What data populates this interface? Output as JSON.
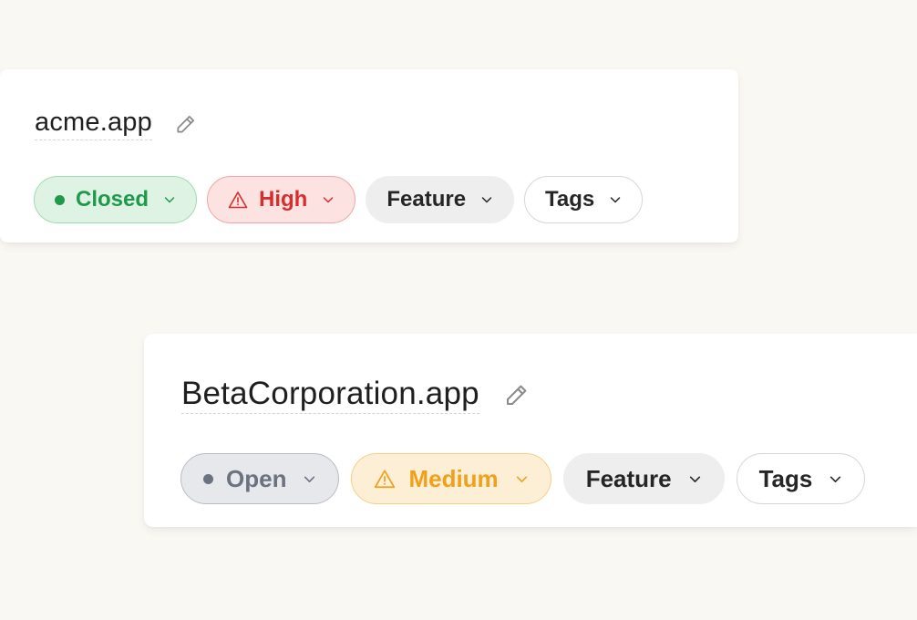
{
  "colors": {
    "background": "#faf8f3",
    "closed": "#1f9a4b",
    "high": "#d62d2d",
    "open": "#6b7280",
    "medium": "#f0a01b"
  },
  "cards": [
    {
      "title": "acme.app",
      "edit_icon": "pencil-icon",
      "pills": {
        "status": {
          "label": "Closed",
          "icon": "dot-icon"
        },
        "priority": {
          "label": "High",
          "icon": "warning-triangle-icon"
        },
        "type": {
          "label": "Feature"
        },
        "tags": {
          "label": "Tags"
        }
      }
    },
    {
      "title": "BetaCorporation.app",
      "edit_icon": "pencil-icon",
      "pills": {
        "status": {
          "label": "Open",
          "icon": "dot-icon"
        },
        "priority": {
          "label": "Medium",
          "icon": "warning-triangle-icon"
        },
        "type": {
          "label": "Feature"
        },
        "tags": {
          "label": "Tags"
        }
      }
    }
  ]
}
